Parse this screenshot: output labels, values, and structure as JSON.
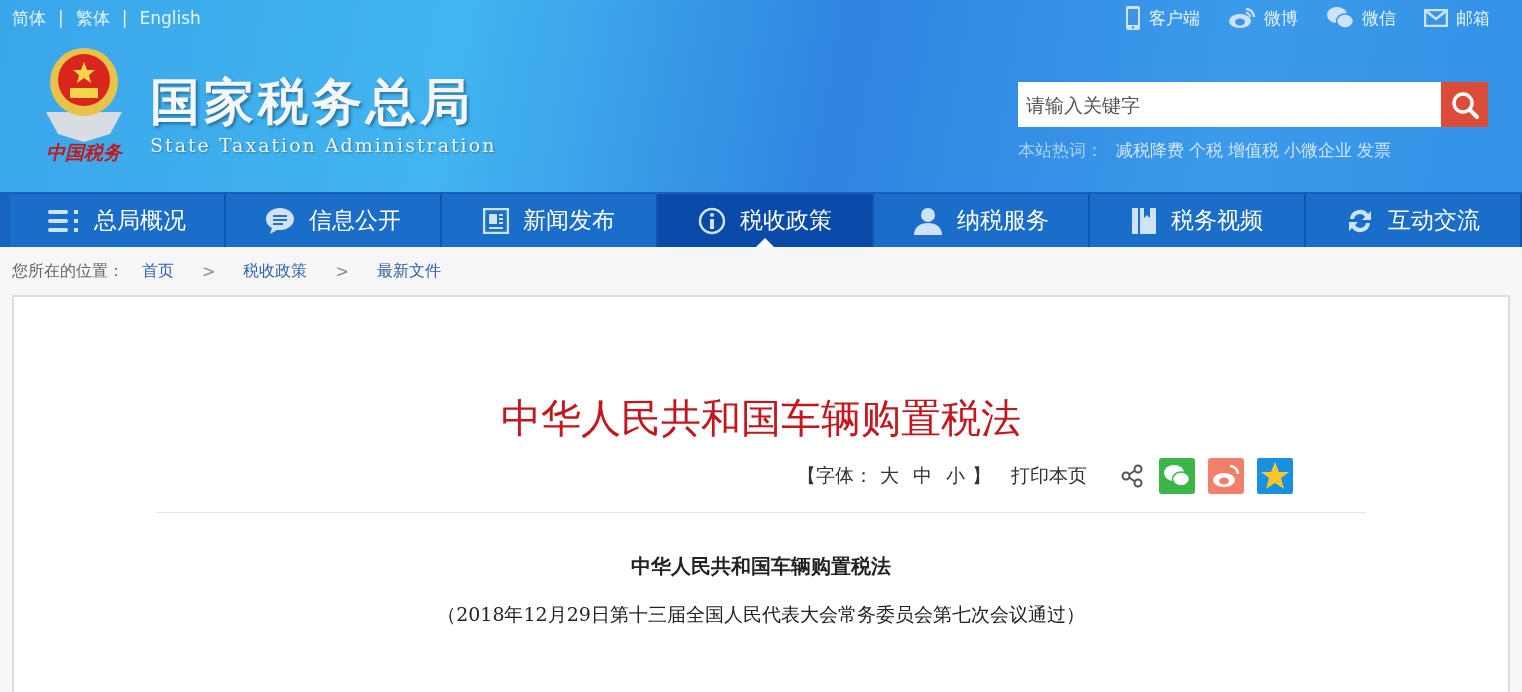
{
  "top_links": {
    "separator": "|",
    "items": [
      "简体",
      "繁体",
      "English"
    ]
  },
  "quick_links": [
    {
      "label": "客户端",
      "kind": "phone"
    },
    {
      "label": "微博",
      "kind": "weibo"
    },
    {
      "label": "微信",
      "kind": "wechat"
    },
    {
      "label": "邮箱",
      "kind": "mail"
    }
  ],
  "logo": {
    "emblem_text": "中国税务",
    "title": "国家税务总局",
    "subtitle": "State Taxation Administration"
  },
  "search": {
    "placeholder": "请输入关键字"
  },
  "hot_words": {
    "label": "本站热词：",
    "words": [
      "减税降费",
      "个税",
      "增值税",
      "小微企业",
      "发票"
    ]
  },
  "nav": [
    {
      "label": "总局概况",
      "kind": "list",
      "selected": false
    },
    {
      "label": "信息公开",
      "kind": "chat",
      "selected": false
    },
    {
      "label": "新闻发布",
      "kind": "news",
      "selected": false
    },
    {
      "label": "税收政策",
      "kind": "info",
      "selected": true
    },
    {
      "label": "纳税服务",
      "kind": "person",
      "selected": false
    },
    {
      "label": "税务视频",
      "kind": "book",
      "selected": false
    },
    {
      "label": "互动交流",
      "kind": "refresh",
      "selected": false
    }
  ],
  "breadcrumb": {
    "label": "您所在的位置：",
    "separator": ">",
    "items": [
      "首页",
      "税收政策",
      "最新文件"
    ]
  },
  "article": {
    "title": "中华人民共和国车辆购置税法",
    "font_size": {
      "open": "【字体：",
      "options": [
        "大",
        "中",
        "小"
      ],
      "close": "】"
    },
    "print": "打印本页",
    "share": [
      {
        "kind": "share"
      },
      {
        "kind": "wechat"
      },
      {
        "kind": "weibo"
      },
      {
        "kind": "qzone"
      }
    ],
    "heading": "中华人民共和国车辆购置税法",
    "note": "（2018年12月29日第十三届全国人民代表大会常务委员会第七次会议通过）"
  }
}
